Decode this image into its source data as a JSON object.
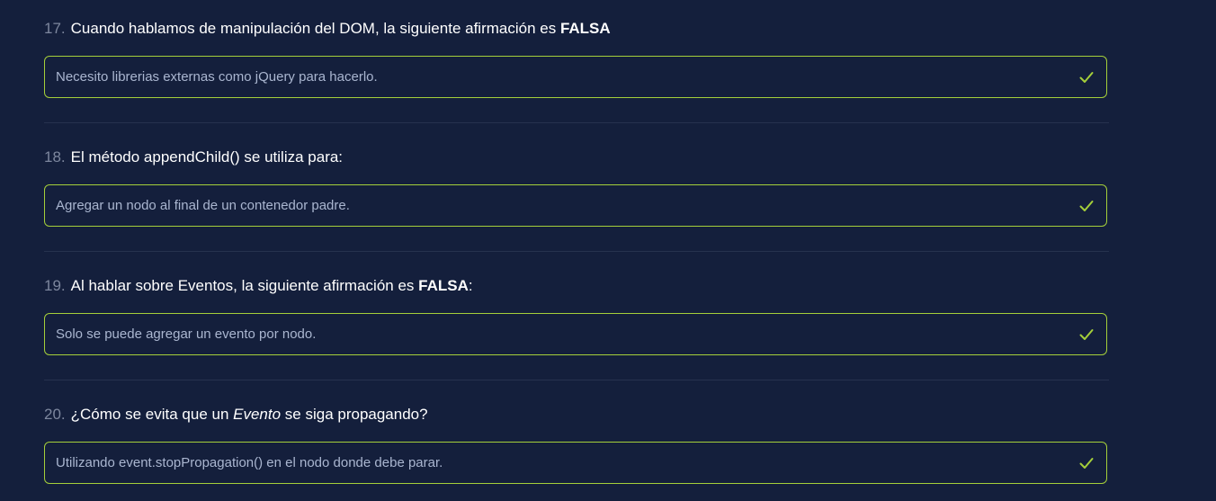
{
  "colors": {
    "background": "#141f3c",
    "correct": "#a5cf3a",
    "number": "#7d879e",
    "answer_text": "#aab6d0"
  },
  "questions": [
    {
      "number": "17.",
      "text_before": "Cuando hablamos de manipulación del DOM, la siguiente afirmación es ",
      "emphasis": "FALSA",
      "text_after": "",
      "answer": "Necesito librerias externas como jQuery para hacerlo.",
      "status_icon": "check-icon"
    },
    {
      "number": "18.",
      "text_before": "El método appendChild() se utiliza para:",
      "emphasis": "",
      "text_after": "",
      "answer": "Agregar un nodo al final de un contenedor padre.",
      "status_icon": "check-icon"
    },
    {
      "number": "19.",
      "text_before": "Al hablar sobre Eventos, la siguiente afirmación es ",
      "emphasis": "FALSA",
      "text_after": ":",
      "answer": "Solo se puede agregar un evento por nodo.",
      "status_icon": "check-icon"
    },
    {
      "number": "20.",
      "text_before": "¿Cómo se evita que un ",
      "italic": "Evento",
      "text_after": " se siga propagando?",
      "answer": "Utilizando event.stopPropagation() en el nodo donde debe parar.",
      "status_icon": "check-icon"
    }
  ]
}
